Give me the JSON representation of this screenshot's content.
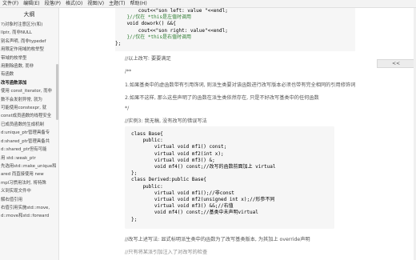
{
  "menubar": {
    "items": [
      "文件(F)",
      "编辑(E)",
      "段落(P)",
      "格式(O)",
      "视图(V)",
      "主题(T)",
      "帮助(H)"
    ]
  },
  "sidebar": {
    "title": "大纲",
    "items": [
      "?)对象时注意区分(和)",
      "llptr, 而非NULL",
      "别名声明, 而非typedef",
      "用限定作用域的枚举型",
      "带域的枚举型",
      "用删除函数, 而非",
      "有函数",
      "改写函数添加",
      "使用 const_iterator, 而非",
      "数不会发射异常, 就为",
      "可能使用constexpr, 就",
      "const成员函数的线程安全",
      "已成员函数的生成机制",
      "d:unique_ptr管理具备专",
      "d:shared_ptr管理具备共",
      "d::shared_ptr但有可能",
      "用 std::weak_ptr",
      "先选用std::make_unique和",
      "ared 而直接使用 new",
      "mpl习惯用法时, 将特殊",
      "义到实现文件中",
      "解右值引用",
      "右值引用实施std::move,",
      "d::move和std::forward"
    ],
    "active_index": 7
  },
  "code_top": {
    "l1": "        cout<<\"son left: value \"<<endl;",
    "l2": "    }//仅在 *this是左值时调用",
    "l3": "    void dowork() &&{",
    "l4": "        cout<<\"son right: value\"<<endl;",
    "l5": "    }//仅在 *this是右值时调用",
    "l6": "};"
  },
  "floating_button": "<<",
  "text": {
    "p1": "//以上改写: 要要满足",
    "p2": "/**",
    "p3": "1.如果基类中的虚函数带有引用饰词, 则派生类要对该函数进行改写版本必须也带有完全相同的引用修饰词",
    "p4": "2.如果不这样, 那么这些声明了的函数在派生类依然存在, 只是不好改写基类中的任何函数",
    "p5": "*/",
    "p6": "//实例3: 我无稿, 没有改写的错误写法",
    "p7": "//改写上述写法: 显式标明派生类中的函数为了改写基类版本, 为其加上 override声明",
    "p8": "//只有将某派引加注入了对改写的检查"
  },
  "code_block": {
    "lines": [
      "class Base{",
      "    public:",
      "        virtual void mf1() const;",
      "        virtual void mf2(int x);",
      "        virtual void mf3() &;",
      "        void mf4() const;//改写的函数前面加上 virtual",
      "};",
      "class Derived:public Base{",
      "    public:",
      "        virtual void mf1();//非const",
      "        virtual void mf2(unsigned int x);//形参不同",
      "        virtual void mf3() &&;//右值",
      "        void mf4() const;//基类中未声明virtual",
      "};"
    ]
  }
}
